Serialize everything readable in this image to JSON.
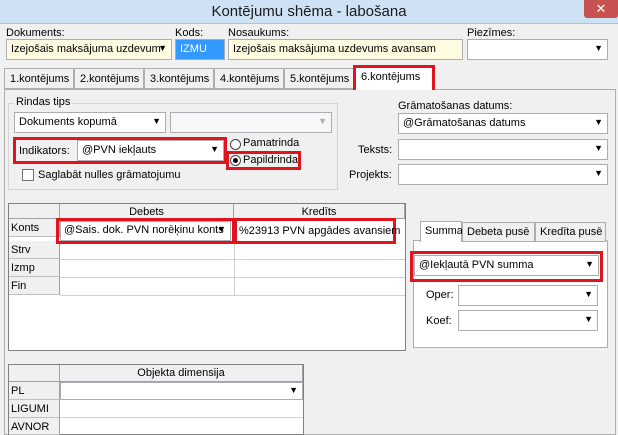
{
  "window": {
    "title": "Kontējumu shēma - labošana",
    "close_glyph": "✕"
  },
  "header": {
    "dokumenti_label": "Dokuments:",
    "dokumenti_value": "Izejošais maksājuma uzdevum",
    "kods_label": "Kods:",
    "kods_value": "IZMU",
    "nosaukums_label": "Nosaukums:",
    "nosaukums_value": "Izejošais maksājuma uzdevums avansam",
    "piezimes_label": "Piezīmes:",
    "piezimes_value": ""
  },
  "tabs": [
    "1.kontējums",
    "2.kontējums",
    "3.kontējums",
    "4.kontējums",
    "5.kontējums",
    "6.kontējums"
  ],
  "active_tab": "6.kontējums",
  "rindas": {
    "group_label": "Rindas tips",
    "type_value": "Dokuments kopumā",
    "type2_value": "",
    "indikators_label": "Indikators:",
    "indikators_value": "@PVN iekļauts",
    "radio_pamatrinda": "Pamatrinda",
    "radio_papildrinda": "Papildrinda",
    "selected_radio": "Papildrinda",
    "checkbox_label": "Saglabāt nulles grāmatojumu",
    "checkbox_checked": false
  },
  "right_fields": {
    "datums_label": "Grāmatošanas datums:",
    "datums_value": "@Grāmatošanas datums",
    "teksts_label": "Teksts:",
    "teksts_value": "",
    "projekts_label": "Projekts:",
    "projekts_value": ""
  },
  "grid": {
    "col_debets": "Debets",
    "col_kredits": "Kredīts",
    "rows": [
      {
        "label": "Konts",
        "debets": "@Sais. dok. PVN norēķinu konts",
        "kredits": "%23913 PVN apgādes avansiem"
      },
      {
        "label": "Strv",
        "debets": "",
        "kredits": ""
      },
      {
        "label": "Izmp",
        "debets": "",
        "kredits": ""
      },
      {
        "label": "Fin",
        "debets": "",
        "kredits": ""
      }
    ]
  },
  "summa": {
    "tabs": [
      "Summa",
      "Debeta pusē",
      "Kredīta pusē"
    ],
    "active_tab": "Summa",
    "value": "@Iekļautā PVN summa",
    "oper_label": "Oper:",
    "oper_value": "",
    "koef_label": "Koef:",
    "koef_value": ""
  },
  "dimensija": {
    "header": "Objekta dimensija",
    "rows": [
      {
        "label": "PL",
        "value": ""
      },
      {
        "label": "LIGUMI",
        "value": ""
      },
      {
        "label": "AVNOR",
        "value": ""
      }
    ]
  }
}
